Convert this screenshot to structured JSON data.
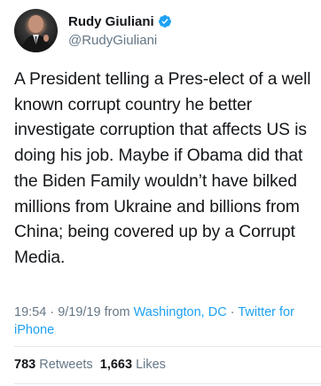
{
  "author": {
    "display_name": "Rudy Giuliani",
    "handle": "@RudyGiuliani",
    "verified_icon": "verified-badge-icon",
    "avatar_icon": "avatar-photo"
  },
  "tweet": {
    "text": "A President telling a Pres-elect of a well known corrupt country he better investigate corruption that affects US is doing his job. Maybe if Obama did that the Biden Family wouldn’t have bilked millions from Ukraine and billions from China; being covered up by a Corrupt Media."
  },
  "meta": {
    "time": "19:54",
    "separator1": " · ",
    "date": "9/19/19",
    "from_text": " from ",
    "location": "Washington, DC",
    "separator2": " · ",
    "source": "Twitter for iPhone"
  },
  "stats": {
    "retweets_count": "783",
    "retweets_label": "Retweets",
    "likes_count": "1,663",
    "likes_label": "Likes"
  },
  "colors": {
    "text": "#14171a",
    "muted": "#657786",
    "link": "#1da1f2",
    "divider": "#e1e8ed"
  }
}
